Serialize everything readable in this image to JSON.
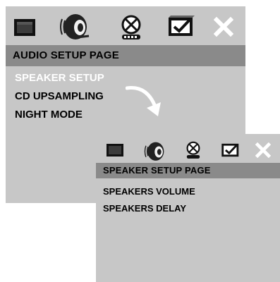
{
  "audio_page": {
    "icons": [
      "general-setup-icon",
      "audio-setup-icon",
      "video-setup-icon",
      "preference-setup-icon",
      "exit-icon"
    ],
    "title": "AUDIO SETUP PAGE",
    "items": [
      {
        "label": "SPEAKER SETUP",
        "selected": true
      },
      {
        "label": "CD UPSAMPLING"
      },
      {
        "label": "NIGHT MODE"
      }
    ]
  },
  "speaker_page": {
    "icons": [
      "general-setup-icon",
      "audio-setup-icon",
      "video-setup-icon",
      "preference-setup-icon",
      "exit-icon"
    ],
    "title": "SPEAKER SETUP PAGE",
    "items": [
      {
        "label": "SPEAKERS VOLUME"
      },
      {
        "label": "SPEAKERS DELAY"
      }
    ]
  },
  "colors": {
    "panel_bg": "#c7c7c7",
    "title_bar": "#8a8a8a",
    "selected_text": "#ffffff",
    "text": "#000000"
  }
}
